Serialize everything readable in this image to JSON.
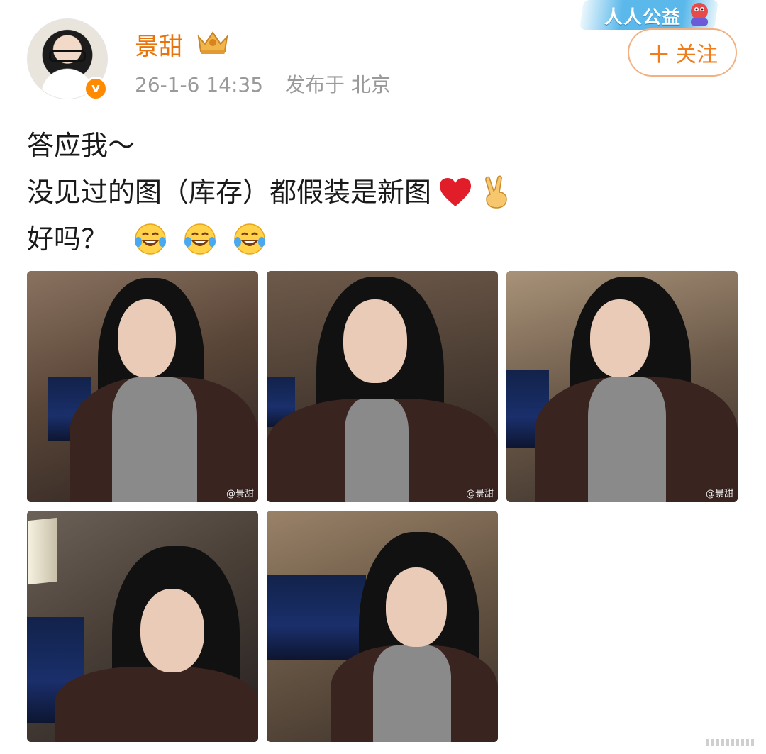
{
  "post": {
    "author": "景甜",
    "timestamp": "26-1-6 14:35",
    "location": "发布于 北京",
    "follow_label": "关注",
    "follow_plus": "＋",
    "verified_badge": "v",
    "charity_badge": "人人公益",
    "text_line1": "答应我～",
    "text_line2": "没见过的图（库存）都假装是新图",
    "text_line3": "好吗？",
    "line2_emojis": [
      "heart-icon",
      "victory-hand-icon"
    ],
    "line3_emojis": [
      "laughing-tears-icon",
      "laughing-tears-icon",
      "laughing-tears-icon"
    ]
  },
  "photos": [
    {
      "watermark": "@景甜"
    },
    {
      "watermark": "@景甜"
    },
    {
      "watermark": "@景甜"
    },
    {
      "watermark": ""
    },
    {
      "watermark": ""
    }
  ],
  "colors": {
    "author": "#e8740c",
    "follow_border": "#f2b182",
    "follow_text": "#f07d1c",
    "meta": "#9a9a9a",
    "verified": "#ff8a00",
    "charity": "#5ab8ea"
  }
}
